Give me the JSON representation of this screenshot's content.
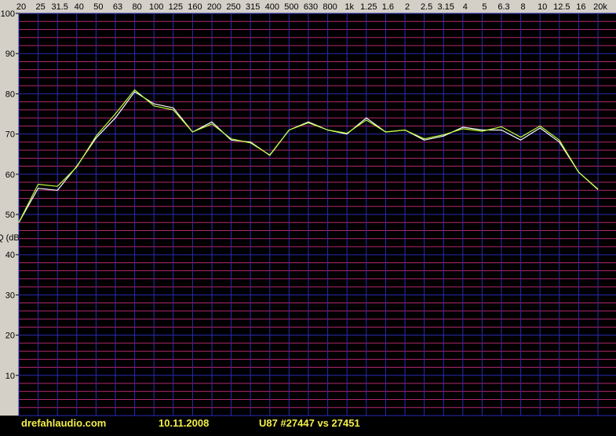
{
  "chart_data": {
    "type": "line",
    "title": "",
    "xlabel": "",
    "ylabel": "Q (dB",
    "x_scale": "log",
    "x_tick_labels": [
      "20",
      "25",
      "31.5",
      "40",
      "50",
      "63",
      "80",
      "100",
      "125",
      "160",
      "200",
      "250",
      "315",
      "400",
      "500",
      "630",
      "800",
      "1k",
      "1.25",
      "1.6",
      "2",
      "2.5",
      "3.15",
      "4",
      "5",
      "6.3",
      "8",
      "10",
      "12.5",
      "16",
      "20k"
    ],
    "ylim": [
      0,
      100
    ],
    "y_tick_labels": [
      "100",
      "90",
      "80",
      "70",
      "60",
      "50",
      "40",
      "30",
      "20",
      "10"
    ],
    "grid": true,
    "series": [
      {
        "color": "#ffffff",
        "values": [
          48,
          56.5,
          56,
          62,
          69,
          74,
          80.5,
          77.5,
          76.5,
          70.5,
          73,
          68.5,
          68,
          64.7,
          71,
          73,
          71,
          70,
          74,
          70.5,
          71,
          68.5,
          69.5,
          71.7,
          71,
          71,
          68.5,
          71.5,
          68,
          60.5,
          56.2
        ]
      },
      {
        "color": "#b8ff3a",
        "values": [
          48,
          57.5,
          57,
          61.8,
          69.5,
          75,
          81,
          77,
          76,
          70.5,
          72.5,
          68.8,
          67.8,
          64.8,
          71,
          72.8,
          71,
          70.2,
          73.5,
          70.5,
          71,
          68.8,
          69.8,
          71.3,
          70.7,
          71.8,
          69.2,
          72,
          68.5,
          60.5,
          56.3
        ]
      }
    ],
    "colors": {
      "background": "#000000",
      "grid_blue": "#2b2bb4",
      "grid_magenta": "#b4286e",
      "text": "#000000",
      "footer_text": "#f2ee4a",
      "frame": "#d4d0c8"
    }
  },
  "footer": {
    "site": "drefahlaudio.com",
    "date": "10.11.2008",
    "description": "U87 #27447 vs 27451"
  }
}
